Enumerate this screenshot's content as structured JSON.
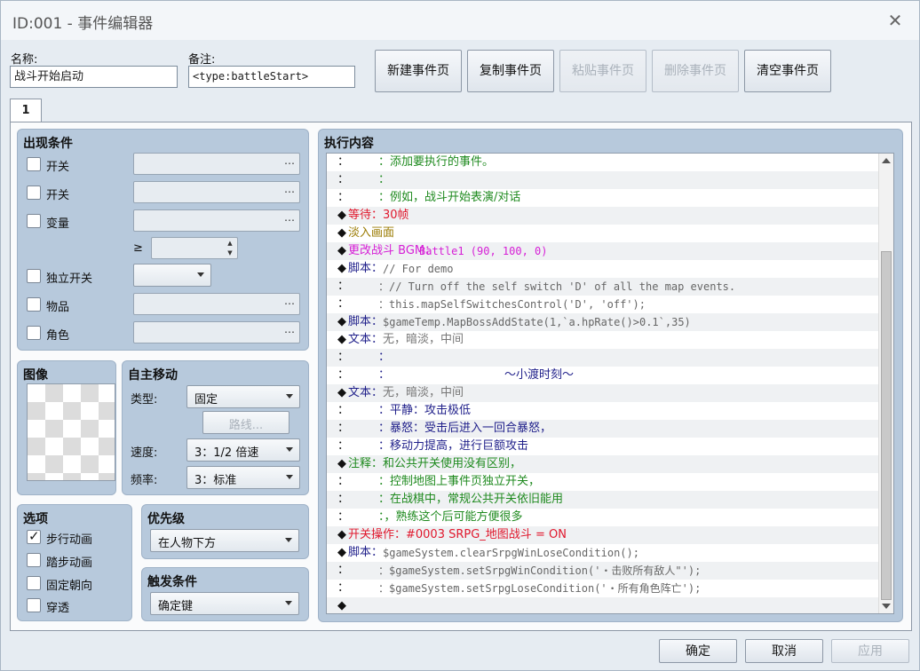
{
  "window": {
    "title": "ID:001 - 事件编辑器",
    "close_glyph": "✕"
  },
  "header": {
    "name_label": "名称:",
    "name_value": "战斗开始启动",
    "note_label": "备注:",
    "note_value": "<type:battleStart>"
  },
  "page_buttons": [
    {
      "label": "新建事件页",
      "enabled": true
    },
    {
      "label": "复制事件页",
      "enabled": true
    },
    {
      "label": "粘贴事件页",
      "enabled": false
    },
    {
      "label": "删除事件页",
      "enabled": false
    },
    {
      "label": "清空事件页",
      "enabled": true
    }
  ],
  "tabs": [
    "1"
  ],
  "conditions": {
    "title": "出现条件",
    "switch1": "开关",
    "switch2": "开关",
    "variable": "变量",
    "ge": "≥",
    "self_switch": "独立开关",
    "item": "物品",
    "actor": "角色",
    "dots": "…"
  },
  "image": {
    "title": "图像"
  },
  "autonomous": {
    "title": "自主移动",
    "type_label": "类型:",
    "type_value": "固定",
    "route_button": "路线...",
    "speed_label": "速度:",
    "speed_value": "3：1/2 倍速",
    "freq_label": "频率:",
    "freq_value": "3：标准"
  },
  "options": {
    "title": "选项",
    "walking": "步行动画",
    "stepping": "踏步动画",
    "direction_fix": "固定朝向",
    "through": "穿透",
    "walking_checked": true
  },
  "priority": {
    "title": "优先级",
    "value": "在人物下方"
  },
  "trigger": {
    "title": "触发条件",
    "value": "确定键"
  },
  "contents": {
    "title": "执行内容",
    "rows": [
      {
        "p": "：",
        "t": "：添加要执行的事件。",
        "c": "#1f8a1f",
        "ind": 1
      },
      {
        "p": "：",
        "t": "：",
        "c": "#1f8a1f",
        "ind": 1
      },
      {
        "p": "：",
        "t": "：例如，战斗开始表演/对话",
        "c": "#1f8a1f",
        "ind": 1
      },
      {
        "p": "◆",
        "k": "等待：",
        "kc": "#e0182d",
        "t": "30帧",
        "c": "#e0182d"
      },
      {
        "p": "◆",
        "k": "淡入画面",
        "kc": "#9a7a00",
        "t": "",
        "c": "#9a7a00"
      },
      {
        "p": "◆",
        "k": "更改战斗 BGM：",
        "kc": "#d61fd6",
        "t": "Battle1 (90, 100, 0)",
        "c": "#d61fd6",
        "m": true
      },
      {
        "p": "◆",
        "k": "脚本：",
        "kc": "#1f1f8a",
        "t": "// For demo",
        "c": "#666",
        "m": true
      },
      {
        "p": "：",
        "t": "：// Turn off the self switch 'D' of all the map events.",
        "c": "#666",
        "ind": 1,
        "m": true
      },
      {
        "p": "：",
        "t": "：this.mapSelfSwitchesControl('D', 'off');",
        "c": "#666",
        "ind": 1,
        "m": true
      },
      {
        "p": "◆",
        "k": "脚本：",
        "kc": "#1f1f8a",
        "t": "$gameTemp.MapBossAddState(1,`a.hpRate()>0.1`,35)",
        "c": "#666",
        "m": true
      },
      {
        "p": "◆",
        "k": "文本：",
        "kc": "#1f1f8a",
        "t": "无，暗淡，中间",
        "c": "#777"
      },
      {
        "p": "：",
        "t": "：",
        "c": "#1f1f8a",
        "ind": 1
      },
      {
        "p": "：",
        "t": "：",
        "c": "#1f1f8a",
        "ind": 1,
        "center": "～小渡时刻～"
      },
      {
        "p": "◆",
        "k": "文本：",
        "kc": "#1f1f8a",
        "t": "无，暗淡，中间",
        "c": "#777"
      },
      {
        "p": "：",
        "t": "：平静：攻击极低",
        "c": "#1f1f8a",
        "ind": 1
      },
      {
        "p": "：",
        "t": "：暴怒：受击后进入一回合暴怒，",
        "c": "#1f1f8a",
        "ind": 1
      },
      {
        "p": "：",
        "t": "：移动力提高，进行巨额攻击",
        "c": "#1f1f8a",
        "ind": 1
      },
      {
        "p": "◆",
        "k": "注释：",
        "kc": "#1f8a1f",
        "t": "和公共开关使用没有区别，",
        "c": "#1f8a1f"
      },
      {
        "p": "：",
        "t": "：控制地图上事件页独立开关，",
        "c": "#1f8a1f",
        "ind": 1
      },
      {
        "p": "：",
        "t": "：在战棋中，常规公共开关依旧能用",
        "c": "#1f8a1f",
        "ind": 1
      },
      {
        "p": "：",
        "t": "：，熟练这个后可能方便很多",
        "c": "#1f8a1f",
        "ind": 1
      },
      {
        "p": "◆",
        "k": "开关操作：",
        "kc": "#e0182d",
        "t": "#0003 SRPG_地图战斗 = ON",
        "c": "#e0182d"
      },
      {
        "p": "◆",
        "k": "脚本：",
        "kc": "#1f1f8a",
        "t": "$gameSystem.clearSrpgWinLoseCondition();",
        "c": "#666",
        "m": true
      },
      {
        "p": "：",
        "t": "：$gameSystem.setSrpgWinCondition('・击败所有敌人\"');",
        "c": "#666",
        "ind": 1,
        "m": true
      },
      {
        "p": "：",
        "t": "：$gameSystem.setSrpgLoseCondition('・所有角色阵亡');",
        "c": "#666",
        "ind": 1,
        "m": true
      },
      {
        "p": "◆",
        "t": "",
        "c": "#111"
      }
    ]
  },
  "footer": {
    "ok": "确定",
    "cancel": "取消",
    "apply": "应用"
  },
  "colors": {
    "accent_group": "#b7c9dc"
  }
}
